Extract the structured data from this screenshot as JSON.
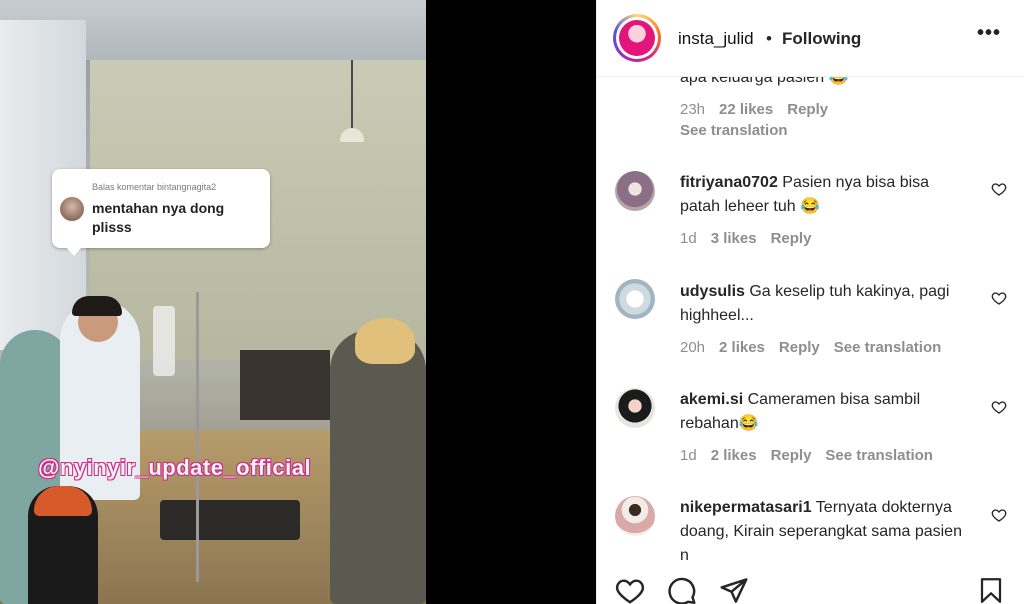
{
  "post": {
    "reply_bubble": {
      "label": "Balas komentar bintangnagita2",
      "text": "mentahan nya dong plisss"
    },
    "watermark": "@nyinyir_update_official"
  },
  "header": {
    "username": "insta_julid",
    "separator": "•",
    "follow_status": "Following",
    "more_glyph": "•••"
  },
  "comments": [
    {
      "text_partial": "apa keluarga pasien 😂",
      "time": "23h",
      "likes": "22 likes",
      "reply": "Reply",
      "translation": "See translation"
    },
    {
      "username": "fitriyana0702",
      "text": "Pasien nya bisa bisa patah leheer tuh 😂",
      "time": "1d",
      "likes": "3 likes",
      "reply": "Reply"
    },
    {
      "username": "udysulis",
      "text": "Ga keselip tuh kakinya, pagi highheel...",
      "time": "20h",
      "likes": "2 likes",
      "reply": "Reply",
      "translation": "See translation"
    },
    {
      "username": "akemi.si",
      "text": "Cameramen bisa sambil rebahan😂",
      "time": "1d",
      "likes": "2 likes",
      "reply": "Reply",
      "translation": "See translation"
    },
    {
      "username": "nikepermatasari1",
      "text": "Ternyata dokternya doang, Kirain seperangkat sama pasien n",
      "time": "",
      "likes": "",
      "reply": ""
    }
  ],
  "actions": {
    "icons": [
      "heart-icon",
      "comment-icon",
      "share-icon",
      "bookmark-icon"
    ]
  }
}
